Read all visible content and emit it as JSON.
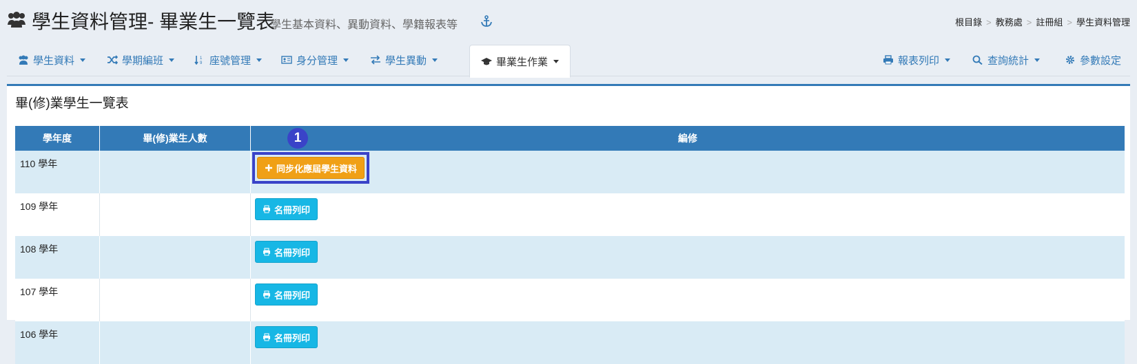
{
  "header": {
    "title": "學生資料管理- 畢業生一覽表",
    "subtitle": "學生基本資料、異動資料、學籍報表等",
    "title_icon": "users-icon",
    "anchor_icon": "anchor-icon"
  },
  "breadcrumb": [
    "根目錄",
    "教務處",
    "註冊組",
    "學生資料管理"
  ],
  "nav": {
    "left_tabs": [
      {
        "label": "學生資料",
        "icon": "users-icon"
      },
      {
        "label": "學期編班",
        "icon": "shuffle-icon"
      },
      {
        "label": "座號管理",
        "icon": "sort-numeric-icon"
      },
      {
        "label": "身分管理",
        "icon": "id-card-icon"
      },
      {
        "label": "學生異動",
        "icon": "exchange-icon"
      },
      {
        "label": "畢業生作業",
        "icon": "graduation-cap-icon",
        "active": true
      }
    ],
    "right_tabs": [
      {
        "label": "報表列印",
        "icon": "print-icon"
      },
      {
        "label": "查詢統計",
        "icon": "search-icon"
      },
      {
        "label": "參數設定",
        "icon": "gear-icon"
      }
    ]
  },
  "panel": {
    "title": "畢(修)業學生一覽表",
    "columns": [
      "學年度",
      "畢(修)業生人數",
      "編修"
    ],
    "rows": [
      {
        "year": "110 學年",
        "count": "",
        "action": "同步化應屆學生資料"
      },
      {
        "year": "109 學年",
        "count": "",
        "action": "名冊列印"
      },
      {
        "year": "108 學年",
        "count": "",
        "action": "名冊列印"
      },
      {
        "year": "107 學年",
        "count": "",
        "action": "名冊列印"
      },
      {
        "year": "106 學年",
        "count": "",
        "action": "名冊列印"
      }
    ]
  },
  "annotation": {
    "step": "1"
  },
  "colors": {
    "primary": "#337ab7",
    "sync_button": "#f0a016",
    "print_button": "#17b7e5",
    "highlight": "#3a43c8"
  }
}
